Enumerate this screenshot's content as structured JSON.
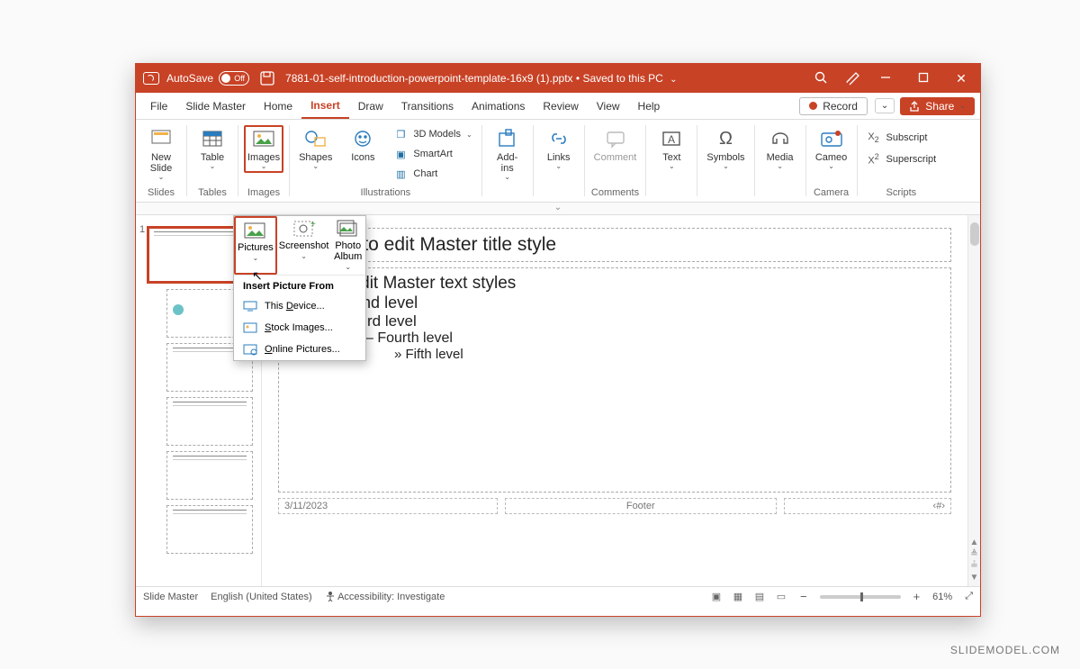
{
  "titlebar": {
    "autosave_label": "AutoSave",
    "autosave_state": "Off",
    "filename": "7881-01-self-introduction-powerpoint-template-16x9 (1).pptx",
    "save_state": "Saved to this PC"
  },
  "tabs": {
    "file": "File",
    "slide_master": "Slide Master",
    "home": "Home",
    "insert": "Insert",
    "draw": "Draw",
    "transitions": "Transitions",
    "animations": "Animations",
    "review": "Review",
    "view": "View",
    "help": "Help",
    "record": "Record",
    "share": "Share"
  },
  "ribbon": {
    "groups": {
      "slides": "Slides",
      "tables": "Tables",
      "images": "Images",
      "illustrations": "Illustrations",
      "addins": "",
      "links": "",
      "comments": "Comments",
      "text": "",
      "symbols": "",
      "media": "",
      "camera": "Camera",
      "scripts": "Scripts"
    },
    "buttons": {
      "new_slide": "New\nSlide",
      "table": "Table",
      "images": "Images",
      "shapes": "Shapes",
      "icons": "Icons",
      "models3d": "3D Models",
      "smartart": "SmartArt",
      "chart": "Chart",
      "addins": "Add-\nins",
      "links": "Links",
      "comment": "Comment",
      "text": "Text",
      "symbols": "Symbols",
      "media": "Media",
      "cameo": "Cameo",
      "subscript": "Subscript",
      "superscript": "Superscript"
    }
  },
  "dropdown": {
    "pictures": "Pictures",
    "screenshot": "Screenshot",
    "photo_album": "Photo\nAlbum",
    "header": "Insert Picture From",
    "items": {
      "this_device": "This Device...",
      "stock_images": "Stock Images...",
      "online_pictures": "Online Pictures..."
    }
  },
  "slide": {
    "title": "Click to edit Master title style",
    "text_level1": "Click to edit Master text styles",
    "text_level2": "Second level",
    "text_level3": "Third level",
    "text_level4": "Fourth level",
    "text_level5": "Fifth level",
    "date": "3/11/2023",
    "footer": "Footer",
    "slidenum": "‹#›"
  },
  "thumbnail_index": "1",
  "status": {
    "mode": "Slide Master",
    "language": "English (United States)",
    "accessibility": "Accessibility: Investigate",
    "zoom": "61%"
  },
  "watermark": "SLIDEMODEL.COM"
}
